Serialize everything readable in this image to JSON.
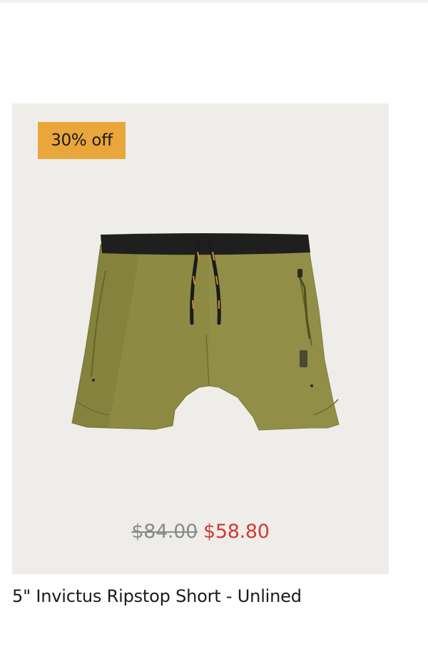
{
  "product": {
    "badge": "30% off",
    "image_icon": "olive-running-shorts-image",
    "price": {
      "original": "$84.00",
      "sale": "$58.80"
    },
    "title": "5\" Invictus Ripstop Short - Unlined"
  },
  "colors": {
    "badge_background": "#e9a63a",
    "panel_background": "#efedea",
    "sale_price": "#d43a34",
    "original_price": "#8a8a8a",
    "shorts_olive": "#8d8b43",
    "waistband": "#1f1f1f"
  }
}
